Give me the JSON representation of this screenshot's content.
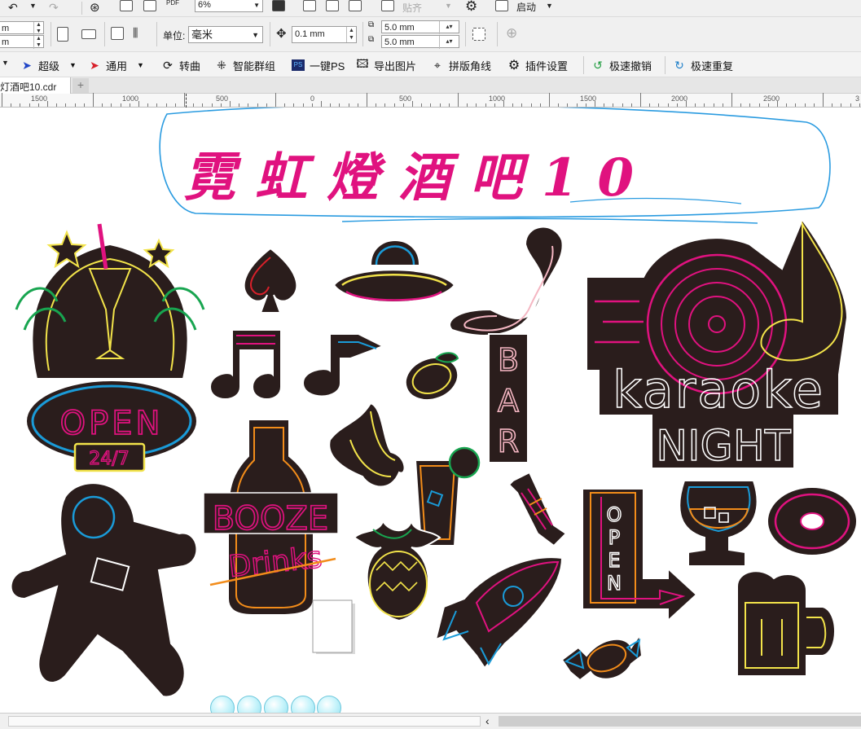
{
  "toolbar_row1": {
    "zoom_value": "6%",
    "snap_label": "贴齐",
    "launch_label": "启动",
    "pdf_label": "PDF"
  },
  "toolbar_row2": {
    "left_field_top": "m",
    "left_field_bottom": "m",
    "units_label": "单位:",
    "units_value": "毫米",
    "nudge_value": "0.1 mm",
    "dup_x": "5.0 mm",
    "dup_y": "5.0 mm"
  },
  "plugin_bar": {
    "items": [
      {
        "label": "超级"
      },
      {
        "label": "通用"
      },
      {
        "label": "转曲"
      },
      {
        "label": "智能群组"
      },
      {
        "label": "一键PS"
      },
      {
        "label": "导出图片"
      },
      {
        "label": "拼版角线"
      },
      {
        "label": "插件设置"
      },
      {
        "label": "极速撤销"
      },
      {
        "label": "极速重复"
      }
    ],
    "ps_badge": "PS"
  },
  "document_tab": {
    "label": "灯酒吧10.cdr",
    "add_label": "+"
  },
  "ruler": {
    "labels": [
      "1500",
      "1000",
      "500",
      "0",
      "500",
      "1000",
      "1500",
      "2000",
      "2500",
      "3"
    ]
  },
  "artwork": {
    "title": "霓虹燈酒吧10",
    "open_sign_text": "OPEN",
    "hours_text": "24/7",
    "bar_letters": [
      "B",
      "A",
      "R"
    ],
    "karaoke_text": "karaoke",
    "night_text": "NIGHT",
    "booze_text": "BOOZE",
    "drinks_text": "Drinks",
    "vertical_open_letters": [
      "O",
      "P",
      "E",
      "N"
    ]
  },
  "colors": {
    "neon_pink": "#e0127f",
    "neon_blue": "#1a9bd8",
    "neon_yellow": "#f2e34a",
    "neon_green": "#18a550",
    "neon_orange": "#f28c1a",
    "sticker_dark": "#2a1d1c",
    "annotation_blue": "#2a9be0"
  },
  "status": {
    "scroll_left_arrow": "‹"
  }
}
